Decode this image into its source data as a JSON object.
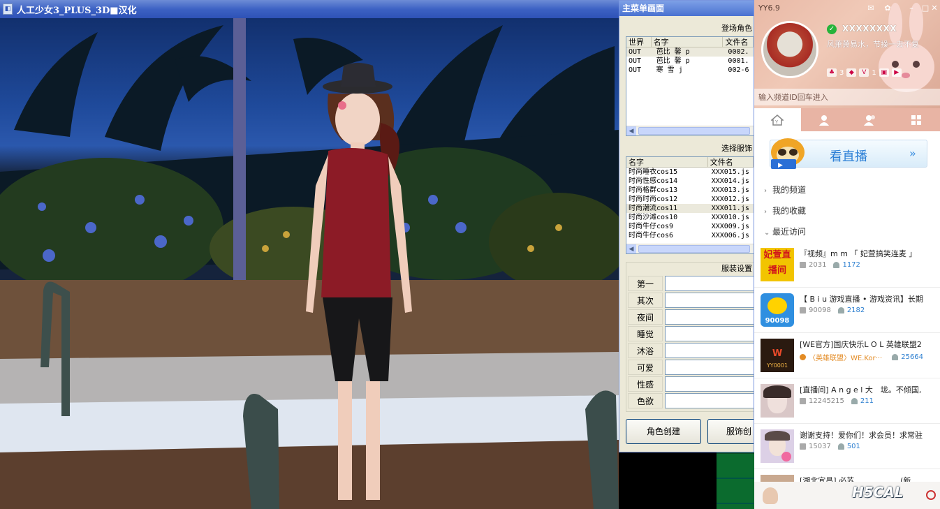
{
  "game": {
    "title": "人工少女3_PLUS_3D■汉化",
    "icon": "app-icon"
  },
  "main_menu": {
    "title": "主菜单画面",
    "characters": {
      "header": "登场角色",
      "columns": [
        "世界",
        "名字",
        "文件名"
      ],
      "rows": [
        {
          "world": "OUT",
          "name": "芭比 馨 p",
          "file": "0002."
        },
        {
          "world": "OUT",
          "name": "芭比 馨 p",
          "file": "0001."
        },
        {
          "world": "OUT",
          "name": "寒 雪 j",
          "file": "002-6"
        }
      ]
    },
    "outfits": {
      "header": "选择服饰",
      "columns": [
        "名字",
        "文件名"
      ],
      "rows": [
        {
          "name": "时尚睡衣cos15",
          "file": "XXX015.js"
        },
        {
          "name": "时尚性感cos14",
          "file": "XXX014.js"
        },
        {
          "name": "时尚格群cos13",
          "file": "XXX013.js"
        },
        {
          "name": "时尚时尚cos12",
          "file": "XXX012.js"
        },
        {
          "name": "时尚潮流cos11",
          "file": "XXX011.js"
        },
        {
          "name": "时尚沙滩cos10",
          "file": "XXX010.js"
        },
        {
          "name": "时尚牛仔cos9",
          "file": "XXX009.js"
        },
        {
          "name": "时尚牛仔cos6",
          "file": "XXX006.js"
        }
      ]
    },
    "outfit_settings": {
      "header": "服装设置",
      "slots": [
        "第一",
        "其次",
        "夜间",
        "睡觉",
        "沐浴",
        "可爱",
        "性感",
        "色欲"
      ]
    },
    "buttons": {
      "create_character": "角色创建",
      "create_outfit": "服饰创"
    }
  },
  "yy": {
    "version": "YY6.9",
    "nickname": "XXXXXXXX",
    "signature": "风萧萧易水，节操一去不复",
    "badges": {
      "diamond_count": "3",
      "vip_level": "1"
    },
    "channel_input_placeholder": "输入频道ID回车进入",
    "tabs": [
      "home-tab-icon",
      "contact-tab-icon",
      "group-tab-icon",
      "apps-tab-icon"
    ],
    "live_banner": "看直播",
    "nav": {
      "my_channels": "我的频道",
      "my_favorites": "我的收藏",
      "recent_visits": "最近访问"
    },
    "channels": [
      {
        "title": "『视频』m m 「 妃萱搞笑连麦 」 ",
        "id": "2031",
        "count": "1172",
        "tag": "",
        "thumb_text": "妃萱直播间",
        "thumb_color": "#f2c400"
      },
      {
        "title": "【 B i u 游戏直播 • 游戏资讯】长期",
        "id": "90098",
        "count": "2182",
        "tag": "",
        "thumb_text": "90098",
        "thumb_color": "#2f8fe0"
      },
      {
        "title": "[WE官方]国庆快乐L O L 英雄联盟2",
        "id": "",
        "count": "25664",
        "tag": "〈英雄联盟〉WE.Kor···",
        "thumb_text": "YY0001",
        "thumb_color": "#2a1a10"
      },
      {
        "title": "[直播间] A n g e l 大　垅。不倾国,",
        "id": "12245215",
        "count": "211",
        "tag": "",
        "thumb_text": "",
        "thumb_color": "#d9c7c7"
      },
      {
        "title": "谢谢支持！爱你们！求会员！求常驻",
        "id": "15037",
        "count": "501",
        "tag": "",
        "thumb_text": "",
        "thumb_color": "#dcd0e6"
      },
      {
        "title": "[湖北宜昌] 必苏　　　　　　(新",
        "id": "",
        "count": "",
        "tag": "",
        "thumb_text": "",
        "thumb_color": "#c9a990"
      }
    ],
    "watermark": "H5CAL"
  }
}
